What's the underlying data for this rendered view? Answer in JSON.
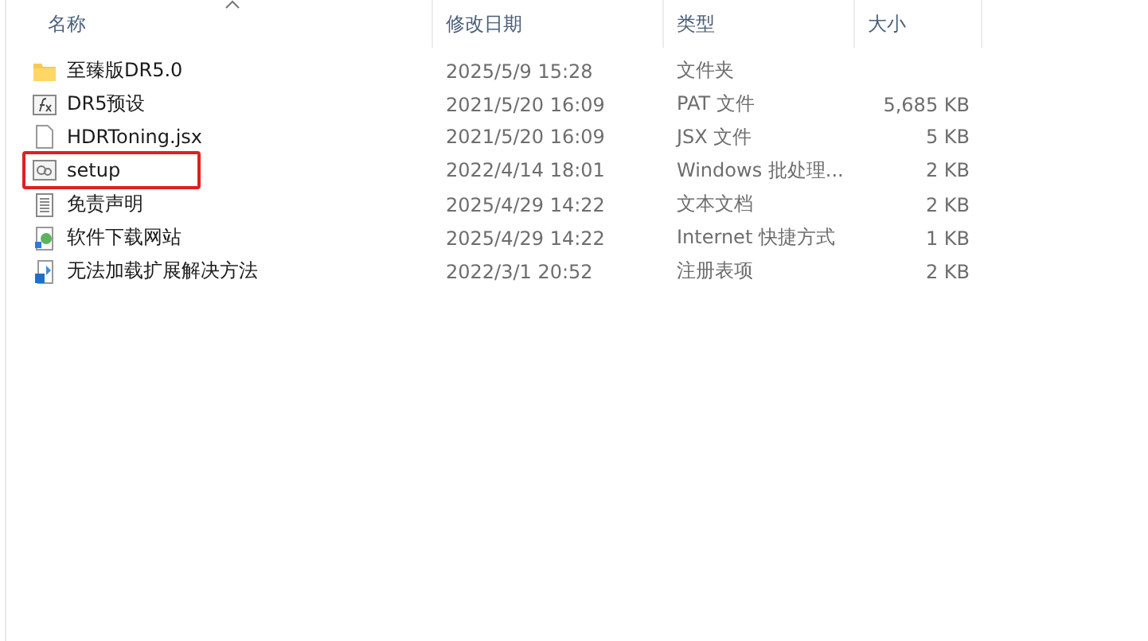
{
  "columns": [
    {
      "label": "名称",
      "sorted": true
    },
    {
      "label": "修改日期",
      "sorted": false
    },
    {
      "label": "类型",
      "sorted": false
    },
    {
      "label": "大小",
      "sorted": false
    }
  ],
  "rows": [
    {
      "kind": "folder",
      "name": "至臻版DR5.0",
      "date": "2025/5/9 15:28",
      "type": "文件夹",
      "highlighted": false
    },
    {
      "kind": "preset",
      "name": "DR5预设",
      "date": "2021/5/20 16:09",
      "type": "PAT 文件",
      "size": "5,685 KB",
      "highlighted": false
    },
    {
      "kind": "file",
      "name": "HDRToning.jsx",
      "date": "2021/5/20 16:09",
      "type": "JSX 文件",
      "size": "5 KB",
      "highlighted": false
    },
    {
      "kind": "batch",
      "name": "setup",
      "date": "2022/4/14 18:01",
      "type": "Windows 批处理...",
      "size": "2 KB",
      "highlighted": true
    },
    {
      "kind": "text",
      "name": "免责声明",
      "date": "2025/4/29 14:22",
      "type": "文本文档",
      "size": "2 KB",
      "highlighted": false
    },
    {
      "kind": "shortcut",
      "name": "软件下载网站",
      "date": "2025/4/29 14:22",
      "type": "Internet 快捷方式",
      "size": "1 KB",
      "highlighted": false
    },
    {
      "kind": "registry",
      "name": "无法加载扩展解决方法",
      "date": "2022/3/1 20:52",
      "type": "注册表项",
      "size": "2 KB",
      "highlighted": false
    }
  ]
}
